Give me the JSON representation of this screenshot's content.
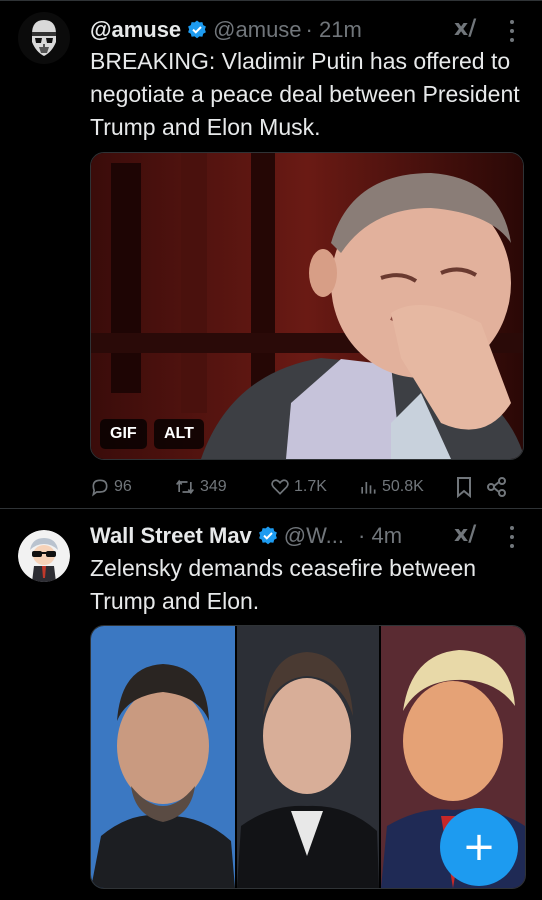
{
  "tweets": [
    {
      "name": "@amuse",
      "handle": "@amuse",
      "time": "· 21m",
      "text": "BREAKING: Vladimir Putin has offered to negotiate a peace deal between President Trump and Elon Musk.",
      "media_badges": [
        "GIF",
        "ALT"
      ],
      "replies": "96",
      "reposts": "349",
      "likes": "1.7K",
      "views": "50.8K"
    },
    {
      "name": "Wall Street Mav",
      "handle": "@W...",
      "time": "· 4m",
      "text": "Zelensky demands ceasefire between Trump and Elon."
    }
  ],
  "fab_label": "+",
  "colors": {
    "accent": "#1d9bf0",
    "muted": "#71767b",
    "text": "#e7e9ea",
    "background": "#000000"
  },
  "icons": [
    "stormtrooper-avatar",
    "wall-street-mav-avatar",
    "verified-icon",
    "grok-icon",
    "more-icon",
    "reply-icon",
    "repost-icon",
    "like-icon",
    "views-icon",
    "bookmark-icon",
    "share-icon",
    "plus-icon"
  ]
}
